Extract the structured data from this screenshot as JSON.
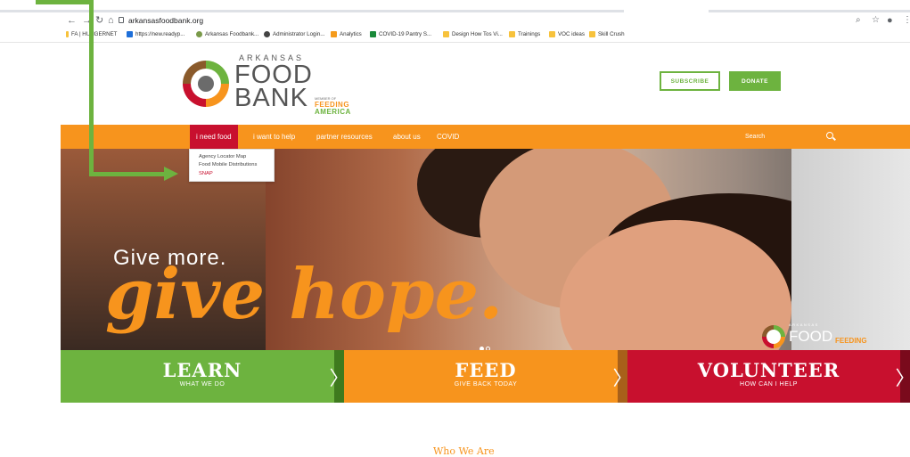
{
  "browser": {
    "url": "arkansasfoodbank.org",
    "bookmarks": [
      "FA | HUNGERNET",
      "https://new.readyp...",
      "Arkansas Foodbank...",
      "Administrator Login...",
      "Analytics",
      "COVID-19 Pantry S...",
      "Design How Tos Vi...",
      "Trainings",
      "VOC ideas",
      "Skill Crush"
    ]
  },
  "logo": {
    "arkansas": "ARKANSAS",
    "food": "FOOD",
    "bank": "BANK",
    "member": "MEMBER OF",
    "feeding": "FEEDING",
    "america": "AMERICA"
  },
  "header": {
    "subscribe": "SUBSCRIBE",
    "donate": "DONATE"
  },
  "nav": {
    "items": [
      "i need food",
      "i want to help",
      "partner resources",
      "about us",
      "COVID"
    ],
    "search_placeholder": "Search"
  },
  "dropdown": [
    "Agency Locator Map",
    "Food Mobile Distributions",
    "SNAP"
  ],
  "hero": {
    "line1": "Give more.",
    "line2": "give hope."
  },
  "hero_logo": {
    "arkansas": "ARKANSAS",
    "food": "FOOD",
    "feeding": "FEEDING"
  },
  "cta": [
    {
      "title": "LEARN",
      "sub": "WHAT WE DO",
      "color": "#6db33f",
      "arrow_bg": "#3e7a1e"
    },
    {
      "title": "FEED",
      "sub": "GIVE BACK TODAY",
      "color": "#f7941d",
      "arrow_bg": "#a8601a"
    },
    {
      "title": "VOLUNTEER",
      "sub": "HOW CAN I HELP",
      "color": "#c8102e",
      "arrow_bg": "#7a0a1c"
    }
  ],
  "who": "Who We Are",
  "colors": {
    "orange": "#f7941d",
    "green": "#6db33f",
    "red": "#c8102e"
  }
}
